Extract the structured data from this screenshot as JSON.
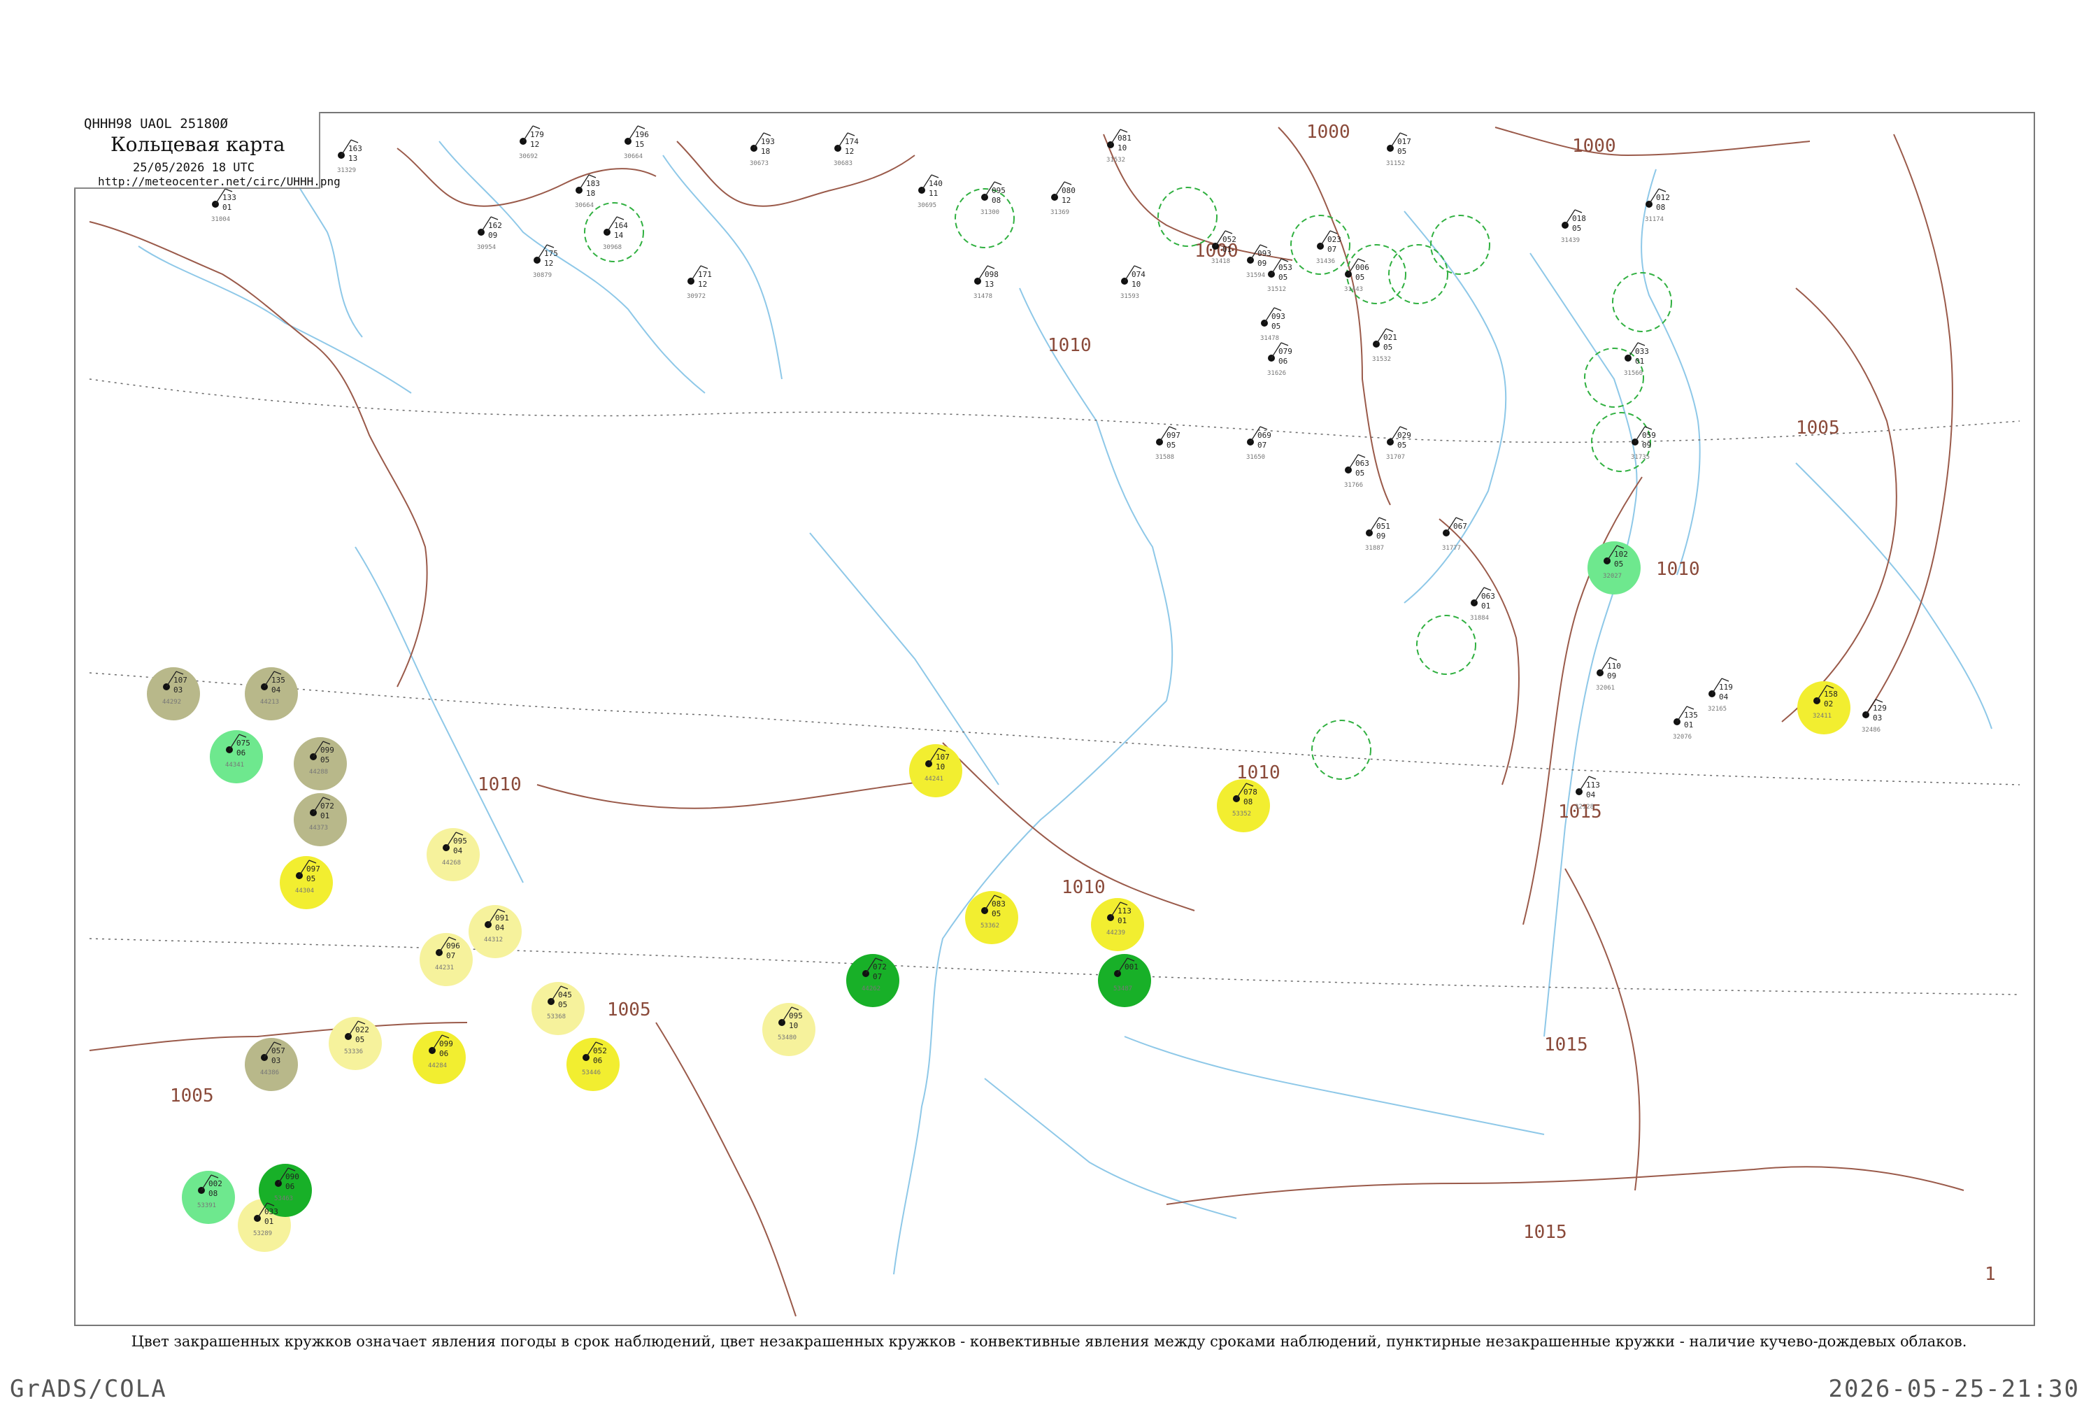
{
  "header": {
    "code": "QHHH98  UAOL  25180Ø",
    "title": "Кольцевая карта",
    "date": "25/05/2026 18 UTC",
    "url": "http://meteocenter.net/circ/UHHH.png"
  },
  "caption": "Цвет закрашенных кружков означает явления погоды в срок наблюдений, цвет незакрашенных кружков - конвективные явления между сроками наблюдений, пунктирные незакрашенные кружки - наличие кучево-дождевых облаков.",
  "footer": {
    "left": "GrADS/COLA",
    "right": "2026-05-25-21:30"
  },
  "colors": {
    "isobar": "#9a5a4a",
    "rivers": "#8ec8e8",
    "green_phenomena": "#18b028",
    "yellow_phenomena": "#f2ee30",
    "light_yellow_phenomena": "#f6f29c",
    "olive_phenomena": "#b8b88a",
    "light_green_phenomena": "#6ee88e",
    "cb_dashed": "#30b040"
  },
  "isobar_labels": [
    "1000",
    "1000",
    "1000",
    "1005",
    "1005",
    "1005",
    "1010",
    "1010",
    "1010",
    "1010",
    "1010",
    "1015",
    "1015",
    "1015",
    "1"
  ],
  "stations": [
    {
      "t": "133",
      "p": "01",
      "v": "",
      "id": "31004",
      "c": ""
    },
    {
      "t": "163",
      "p": "13",
      "v": "",
      "id": "31329",
      "c": ""
    },
    {
      "t": "179",
      "p": "12",
      "v": "",
      "id": "30692",
      "c": ""
    },
    {
      "t": "196",
      "p": "15",
      "v": "",
      "id": "30664",
      "c": ""
    },
    {
      "t": "193",
      "p": "18",
      "v": "",
      "id": "30673",
      "c": ""
    },
    {
      "t": "174",
      "p": "12",
      "v": "",
      "id": "30683",
      "c": ""
    },
    {
      "t": "140",
      "p": "11",
      "v": "",
      "id": "30695",
      "c": ""
    },
    {
      "t": "095",
      "p": "08",
      "v": "",
      "id": "31300",
      "c": ""
    },
    {
      "t": "080",
      "p": "12",
      "v": "",
      "id": "31369",
      "c": ""
    },
    {
      "t": "081",
      "p": "10",
      "v": "",
      "id": "31532",
      "c": ""
    },
    {
      "t": "052",
      "p": "01",
      "v": "",
      "id": "31418",
      "c": ""
    },
    {
      "t": "023",
      "p": "07",
      "v": "",
      "id": "31436",
      "c": ""
    },
    {
      "t": "017",
      "p": "05",
      "v": "",
      "id": "31152",
      "c": ""
    },
    {
      "t": "012",
      "p": "08",
      "v": "",
      "id": "31174",
      "c": ""
    },
    {
      "t": "018",
      "p": "05",
      "v": "",
      "id": "31439",
      "c": ""
    },
    {
      "t": "162",
      "p": "09",
      "v": "",
      "id": "30954",
      "c": ""
    },
    {
      "t": "183",
      "p": "18",
      "v": "",
      "id": "30664",
      "c": ""
    },
    {
      "t": "164",
      "p": "14",
      "v": "",
      "id": "30968",
      "c": ""
    },
    {
      "t": "175",
      "p": "12",
      "v": "",
      "id": "30879",
      "c": ""
    },
    {
      "t": "171",
      "p": "12",
      "v": "",
      "id": "30972",
      "c": ""
    },
    {
      "t": "098",
      "p": "13",
      "v": "",
      "id": "31478",
      "c": ""
    },
    {
      "t": "074",
      "p": "10",
      "v": "",
      "id": "31593",
      "c": ""
    },
    {
      "t": "093",
      "p": "09",
      "v": "",
      "id": "31594",
      "c": ""
    },
    {
      "t": "053",
      "p": "05",
      "v": "",
      "id": "31512",
      "c": ""
    },
    {
      "t": "006",
      "p": "05",
      "v": "",
      "id": "31443",
      "c": ""
    },
    {
      "t": "093",
      "p": "05",
      "v": "",
      "id": "31478",
      "c": ""
    },
    {
      "t": "021",
      "p": "05",
      "v": "",
      "id": "31532",
      "c": ""
    },
    {
      "t": "033",
      "p": "01",
      "v": "",
      "id": "31560",
      "c": ""
    },
    {
      "t": "059",
      "p": "09",
      "v": "",
      "id": "31735",
      "c": ""
    },
    {
      "t": "097",
      "p": "05",
      "v": "",
      "id": "31588",
      "c": ""
    },
    {
      "t": "079",
      "p": "06",
      "v": "",
      "id": "31626",
      "c": ""
    },
    {
      "t": "069",
      "p": "07",
      "v": "",
      "id": "31650",
      "c": ""
    },
    {
      "t": "029",
      "p": "05",
      "v": "",
      "id": "31707",
      "c": ""
    },
    {
      "t": "063",
      "p": "05",
      "v": "",
      "id": "31766",
      "c": ""
    },
    {
      "t": "051",
      "p": "09",
      "v": "",
      "id": "31887",
      "c": ""
    },
    {
      "t": "067",
      "p": "",
      "v": "",
      "id": "31777",
      "c": ""
    },
    {
      "t": "063",
      "p": "01",
      "v": "",
      "id": "31884",
      "c": ""
    },
    {
      "t": "102",
      "p": "05",
      "v": "",
      "id": "32027",
      "c": "light-green"
    },
    {
      "t": "158",
      "p": "02",
      "v": "",
      "id": "32411",
      "c": "yellow"
    },
    {
      "t": "129",
      "p": "03",
      "v": "",
      "id": "32486",
      "c": ""
    },
    {
      "t": "119",
      "p": "04",
      "v": "",
      "id": "32165",
      "c": ""
    },
    {
      "t": "135",
      "p": "01",
      "v": "",
      "id": "32076",
      "c": ""
    },
    {
      "t": "110",
      "p": "09",
      "v": "",
      "id": "32061",
      "c": ""
    },
    {
      "t": "113",
      "p": "04",
      "v": "",
      "id": "32128",
      "c": ""
    },
    {
      "t": "107",
      "p": "03",
      "v": "",
      "id": "44292",
      "c": "olive"
    },
    {
      "t": "135",
      "p": "04",
      "v": "",
      "id": "44213",
      "c": "olive"
    },
    {
      "t": "099",
      "p": "05",
      "v": "",
      "id": "44288",
      "c": "olive"
    },
    {
      "t": "072",
      "p": "01",
      "v": "",
      "id": "44373",
      "c": "olive"
    },
    {
      "t": "075",
      "p": "06",
      "v": "",
      "id": "44341",
      "c": "light-green"
    },
    {
      "t": "097",
      "p": "05",
      "v": "",
      "id": "44304",
      "c": "yellow"
    },
    {
      "t": "057",
      "p": "03",
      "v": "",
      "id": "44386",
      "c": "olive"
    },
    {
      "t": "095",
      "p": "04",
      "v": "",
      "id": "44268",
      "c": "light-yellow"
    },
    {
      "t": "096",
      "p": "07",
      "v": "",
      "id": "44231",
      "c": "light-yellow"
    },
    {
      "t": "099",
      "p": "06",
      "v": "",
      "id": "44284",
      "c": "yellow"
    },
    {
      "t": "107",
      "p": "10",
      "v": "",
      "id": "44241",
      "c": "yellow"
    },
    {
      "t": "078",
      "p": "08",
      "v": "",
      "id": "53352",
      "c": "yellow"
    },
    {
      "t": "113",
      "p": "01",
      "v": "",
      "id": "44239",
      "c": "yellow"
    },
    {
      "t": "083",
      "p": "05",
      "v": "",
      "id": "53362",
      "c": "yellow"
    },
    {
      "t": "091",
      "p": "04",
      "v": "",
      "id": "44312",
      "c": "light-yellow"
    },
    {
      "t": "045",
      "p": "05",
      "v": "",
      "id": "53368",
      "c": "light-yellow"
    },
    {
      "t": "052",
      "p": "06",
      "v": "",
      "id": "53446",
      "c": "yellow"
    },
    {
      "t": "022",
      "p": "05",
      "v": "",
      "id": "53336",
      "c": "light-yellow"
    },
    {
      "t": "033",
      "p": "01",
      "v": "",
      "id": "53289",
      "c": "light-yellow"
    },
    {
      "t": "002",
      "p": "08",
      "v": "",
      "id": "53391",
      "c": "light-green"
    },
    {
      "t": "090",
      "p": "06",
      "v": "",
      "id": "53463",
      "c": "green"
    },
    {
      "t": "095",
      "p": "10",
      "v": "",
      "id": "53480",
      "c": "light-yellow"
    },
    {
      "t": "001",
      "p": "",
      "v": "",
      "id": "53487",
      "c": "green"
    },
    {
      "t": "072",
      "p": "07",
      "v": "",
      "id": "44262",
      "c": "green"
    }
  ]
}
